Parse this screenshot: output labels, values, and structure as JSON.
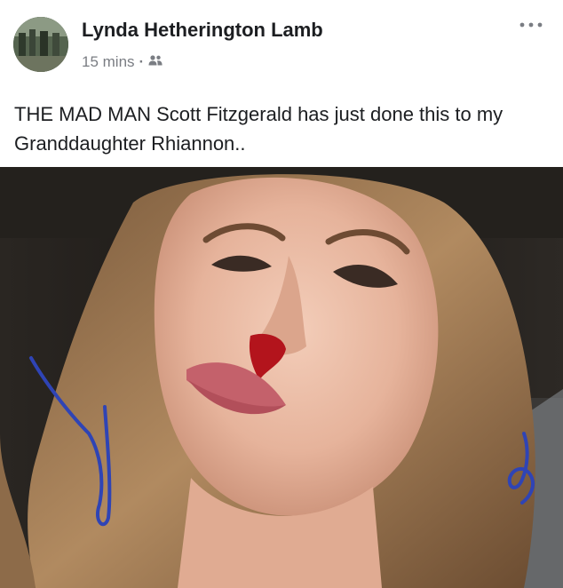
{
  "post": {
    "author": "Lynda Hetherington Lamb",
    "timestamp": "15 mins",
    "separator": "·",
    "audience_icon": "friends-icon",
    "more_icon": "more-options-icon",
    "text": "THE MAD MAN Scott Fitzgerald has just done this to my Granddaughter  Rhiannon.."
  },
  "colors": {
    "author": "#1c1e21",
    "meta": "#7a7d83",
    "annotation_ink": "#2f44b5",
    "blood": "#b3141c"
  }
}
